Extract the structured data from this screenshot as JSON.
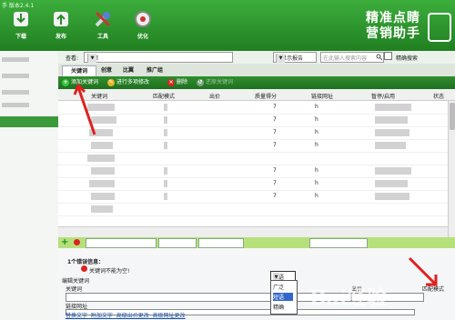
{
  "app": {
    "title": "手 版本2.4.1",
    "brand_line1": "精准点睛",
    "brand_line2": "营销助手"
  },
  "toolbar": {
    "download": "下载",
    "publish": "发布",
    "tools": "工具",
    "optimize": "优化"
  },
  "filter": {
    "label": "查看:",
    "scope_value": "全部",
    "report_value": "不显示报告",
    "search_placeholder": "在此输入搜索内容",
    "exact_label": "精确搜索"
  },
  "tabs": [
    {
      "label": "关键词"
    },
    {
      "label": "创意"
    },
    {
      "label": "比翼"
    },
    {
      "label": "推广组"
    }
  ],
  "actions": {
    "add_keyword": "添加关键词",
    "bulk_edit": "进行多项修改",
    "delete": "删除",
    "restore": "还原关键词"
  },
  "table": {
    "columns": [
      "关键词",
      "匹配模式",
      "出价",
      "质量得分",
      "链接网址",
      "暂停/启用",
      "状态"
    ],
    "rows": [
      {
        "quality": "7",
        "url": "h"
      },
      {
        "quality": "7",
        "url": "h"
      },
      {
        "quality": "7",
        "url": "h"
      },
      {
        "quality": "7",
        "url": "h"
      },
      {
        "quality": "",
        "url": ""
      },
      {
        "quality": "7",
        "url": "h"
      },
      {
        "quality": "7",
        "url": "h"
      },
      {
        "quality": "7",
        "url": "h"
      },
      {
        "quality": "",
        "url": ""
      },
      {
        "quality": "",
        "url": ""
      }
    ]
  },
  "errors": {
    "header": "1个错误信息：",
    "message": "关键词不能为空!"
  },
  "editor": {
    "section_title": "编辑关键词",
    "keyword_label": "关键词",
    "bid_label": "出价",
    "match_label": "匹配模式",
    "match_value": "短语",
    "match_options": [
      "广泛",
      "短语",
      "精确"
    ],
    "url_label": "链接网址",
    "links": [
      "替换文字",
      "附加文字",
      "高级出价更改",
      "高级网址更改"
    ]
  },
  "watermark": "Bai经验"
}
